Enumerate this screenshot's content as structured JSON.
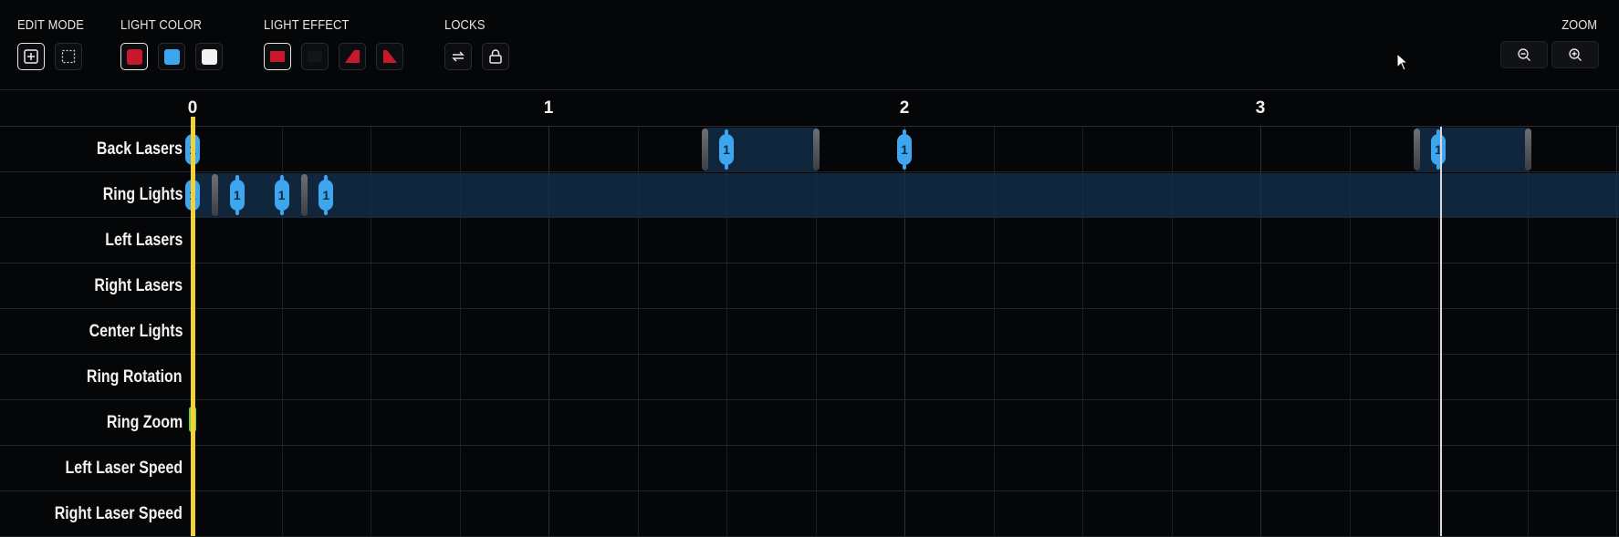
{
  "toolbar": {
    "edit_mode": {
      "title": "EDIT MODE",
      "buttons": [
        {
          "icon": "plus-square-icon",
          "active": true
        },
        {
          "icon": "dashed-select-icon",
          "active": false
        }
      ]
    },
    "light_color": {
      "title": "LIGHT COLOR",
      "swatches": [
        {
          "color": "#c8182b",
          "active": true
        },
        {
          "color": "#3ea6ef",
          "active": false
        },
        {
          "color": "#f2f2f2",
          "active": false
        }
      ]
    },
    "light_effect": {
      "title": "LIGHT EFFECT",
      "buttons": [
        {
          "icon": "effect-on-icon",
          "active": true
        },
        {
          "icon": "effect-off-icon",
          "active": false
        },
        {
          "icon": "effect-flash-icon",
          "active": false
        },
        {
          "icon": "effect-fade-icon",
          "active": false
        }
      ]
    },
    "locks": {
      "title": "LOCKS",
      "buttons": [
        {
          "icon": "loop-icon",
          "active": false
        },
        {
          "icon": "lock-icon",
          "active": false
        }
      ]
    },
    "zoom": {
      "title": "ZOOM",
      "buttons": [
        {
          "icon": "zoom-out-icon"
        },
        {
          "icon": "zoom-in-icon"
        }
      ]
    }
  },
  "timeline": {
    "beats": [
      "0",
      "1",
      "2",
      "3"
    ],
    "tracks": [
      {
        "label": "Back Lasers"
      },
      {
        "label": "Ring Lights"
      },
      {
        "label": "Left Lasers"
      },
      {
        "label": "Right Lasers"
      },
      {
        "label": "Center Lights"
      },
      {
        "label": "Ring Rotation"
      },
      {
        "label": "Ring Zoom"
      },
      {
        "label": "Left Laser Speed"
      },
      {
        "label": "Right Laser Speed"
      }
    ],
    "events": [
      {
        "track": 0,
        "beat": 0.0,
        "label": "1"
      },
      {
        "track": 0,
        "beat": 1.5,
        "label": "1"
      },
      {
        "track": 0,
        "beat": 2.0,
        "label": "1"
      },
      {
        "track": 0,
        "beat": 3.5,
        "label": "1"
      },
      {
        "track": 1,
        "beat": 0.0,
        "label": "1"
      },
      {
        "track": 1,
        "beat": 0.125,
        "label": "1"
      },
      {
        "track": 1,
        "beat": 0.25,
        "label": "1"
      },
      {
        "track": 1,
        "beat": 0.375,
        "label": "1"
      }
    ],
    "colors": {
      "accent": "#3ea6ef",
      "playhead": "#f2d23a",
      "red": "#c8182b"
    }
  }
}
